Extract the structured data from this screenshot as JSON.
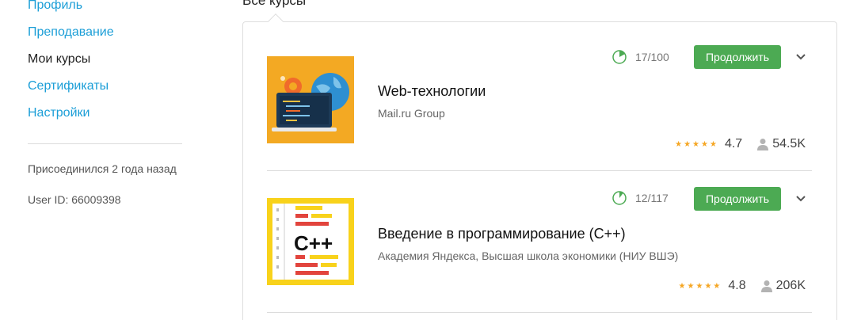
{
  "sidebar": {
    "items": [
      {
        "label": "Профиль"
      },
      {
        "label": "Преподавание"
      },
      {
        "label": "Мои курсы"
      },
      {
        "label": "Сертификаты"
      },
      {
        "label": "Настройки"
      }
    ],
    "joined": "Присоединился 2 года назад",
    "user_id": "User ID: 66009398"
  },
  "main": {
    "section_title": "Все курсы",
    "courses": [
      {
        "title": "Web-технологии",
        "org": "Mail.ru Group",
        "progress_text": "17/100",
        "progress_fraction": 0.17,
        "button": "Продолжить",
        "rating": "4.7",
        "learners": "54.5K",
        "thumb_icon": "web-technologies-icon"
      },
      {
        "title": "Введение в программирование (C++)",
        "org": "Академия Яндекса,  Высшая школа экономики (НИУ ВШЭ)",
        "progress_text": "12/117",
        "progress_fraction": 0.103,
        "button": "Продолжить",
        "rating": "4.8",
        "learners": "206K",
        "thumb_icon": "cpp-icon",
        "thumb_text": "C++"
      }
    ]
  },
  "colors": {
    "link": "#1b9ed7",
    "button": "#4caa53",
    "star": "#f5a623",
    "progress": "#4caa53"
  }
}
